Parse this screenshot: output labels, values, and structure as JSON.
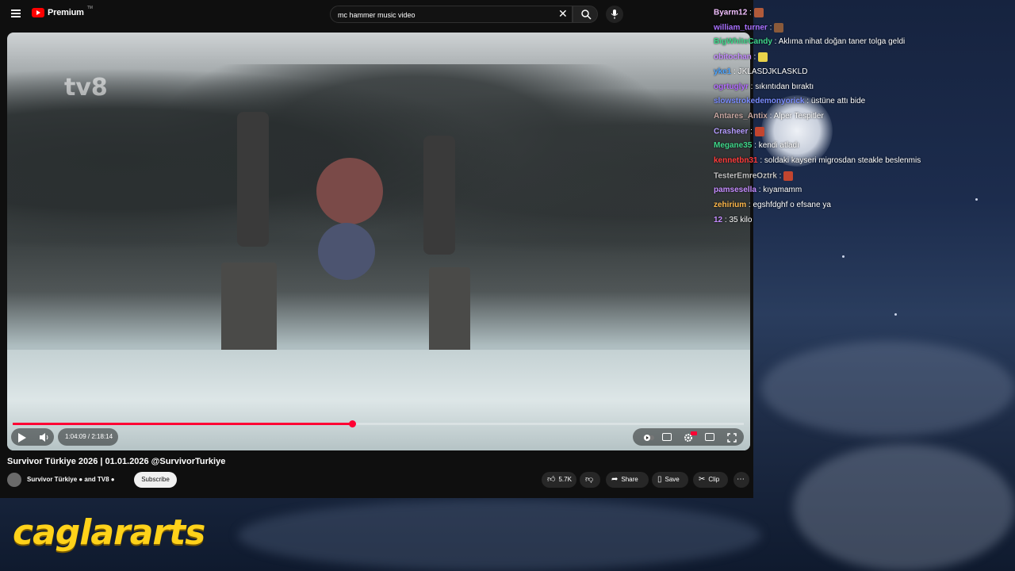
{
  "app": {
    "premium_label": "Premium",
    "premium_tm": "TM",
    "search_value": "mc hammer music video"
  },
  "player": {
    "watermark": "tv8",
    "time": "1:04:09 / 2:18:14",
    "progress": 0.464,
    "accent": "#ff0033"
  },
  "video": {
    "title": "Survivor Türkiye 2026 | 01.01.2026 @SurvivorTurkiye",
    "channel": "Survivor Türkiye ● and TV8 ●",
    "subscribe": "Subscribe",
    "likes": "5.7K",
    "share": "Share",
    "save": "Save",
    "clip": "Clip"
  },
  "chat": [
    {
      "user": "Byarm12",
      "color": "#f2c0ff",
      "text": "",
      "emote": "#b05a3a"
    },
    {
      "user": "william_turner",
      "color": "#a970ff",
      "text": "",
      "emote": "#8a5a3a"
    },
    {
      "user": "BigWhiteCandy",
      "color": "#3fd78a",
      "text": "Aklıma nihat doğan taner tolga geldi"
    },
    {
      "user": "obitochan",
      "color": "#c58cff",
      "text": "",
      "emote": "#e8d24a"
    },
    {
      "user": "yke1",
      "color": "#4aa3ff",
      "text": "JKLASDJKLASKLD"
    },
    {
      "user": "ogrtuglyr",
      "color": "#b36bff",
      "text": "sıkıntıdan bıraktı"
    },
    {
      "user": "slowstrokedemonyorick",
      "color": "#7a8cff",
      "text": "üstüne attı bide"
    },
    {
      "user": "Antares_Antix",
      "color": "#c7a6a0",
      "text": "Alper Tespitler"
    },
    {
      "user": "Crasheer",
      "color": "#b59cff",
      "text": "",
      "emote": "#c2452f"
    },
    {
      "user": "Megane35",
      "color": "#3fd78a",
      "text": "kendi atladı"
    },
    {
      "user": "kennetbn31",
      "color": "#ff3b3b",
      "text": "soldaki kayseri migrosdan steakle beslenmis"
    },
    {
      "user": "TesterEmreOztrk",
      "color": "#c0c0c0",
      "text": "",
      "emote": "#c2452f"
    },
    {
      "user": "pamsesella",
      "color": "#c58cff",
      "text": "kıyamamm"
    },
    {
      "user": "zehirium",
      "color": "#ffb84a",
      "text": "egshfdghf o efsane ya"
    },
    {
      "user": "12",
      "color": "#c58cff",
      "text": "35 kilo"
    }
  ],
  "brand": "caglararts"
}
